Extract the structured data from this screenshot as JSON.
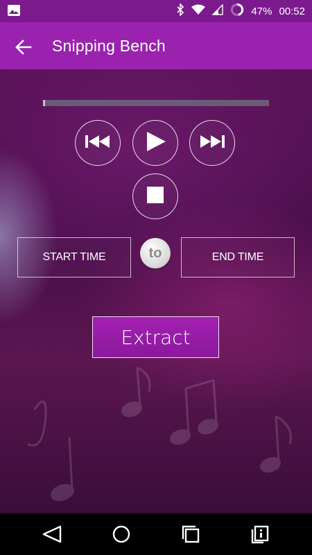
{
  "status_bar": {
    "battery": "47%",
    "time": "00:52",
    "icons": [
      "image-notification-icon",
      "bluetooth-icon",
      "wifi-icon",
      "signal-icon",
      "battery-icon"
    ]
  },
  "app_bar": {
    "title": "Snipping Bench",
    "back_icon": "arrow-back-icon"
  },
  "player": {
    "progress": 0,
    "buttons": [
      "rewind-icon",
      "play-icon",
      "fast-forward-icon",
      "stop-icon"
    ]
  },
  "time_range": {
    "start_label": "START TIME",
    "connector": "to",
    "end_label": "END TIME"
  },
  "extract": {
    "label": "Extract"
  },
  "nav_bar": {
    "icons": [
      "nav-back-icon",
      "nav-home-icon",
      "nav-recents-icon",
      "nav-menu-icon"
    ]
  },
  "colors": {
    "status_bar": "#7a1a8c",
    "app_bar": "#9b22ae",
    "accent": "#a41fb3",
    "background": "#4a0f4a"
  }
}
